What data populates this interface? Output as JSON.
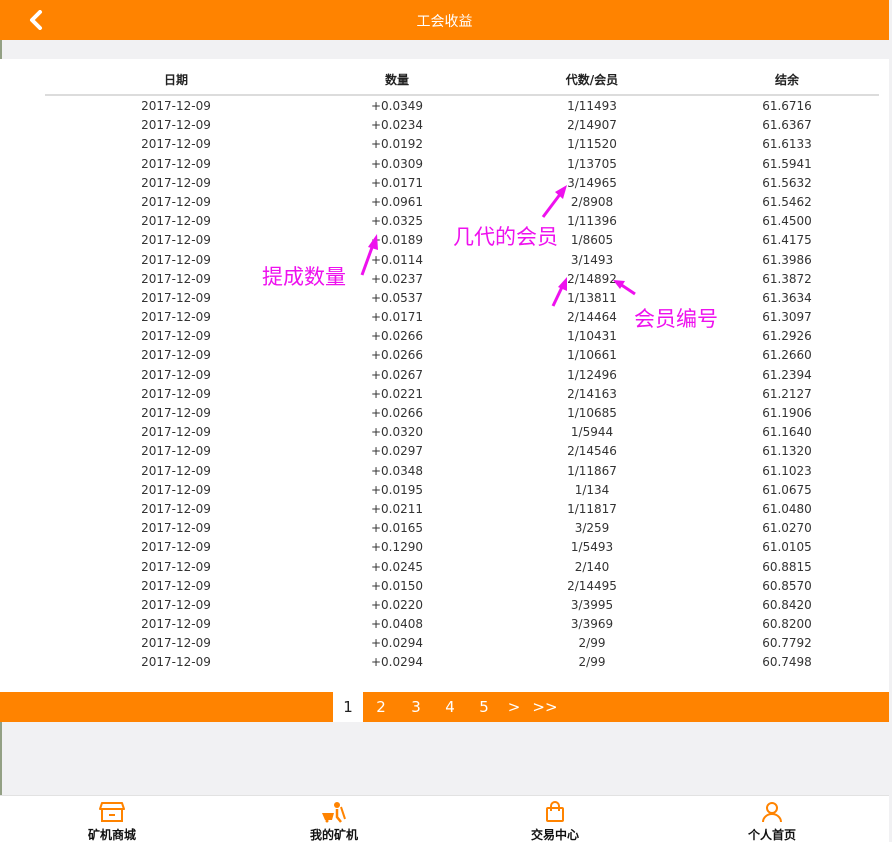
{
  "header": {
    "title": "工会收益",
    "back_icon": "chevron-left-icon"
  },
  "table": {
    "columns": [
      "日期",
      "数量",
      "代数/会员",
      "结余"
    ],
    "rows": [
      [
        "2017-12-09",
        "+0.0349",
        "1/11493",
        "61.6716"
      ],
      [
        "2017-12-09",
        "+0.0234",
        "2/14907",
        "61.6367"
      ],
      [
        "2017-12-09",
        "+0.0192",
        "1/11520",
        "61.6133"
      ],
      [
        "2017-12-09",
        "+0.0309",
        "1/13705",
        "61.5941"
      ],
      [
        "2017-12-09",
        "+0.0171",
        "3/14965",
        "61.5632"
      ],
      [
        "2017-12-09",
        "+0.0961",
        "2/8908",
        "61.5462"
      ],
      [
        "2017-12-09",
        "+0.0325",
        "1/11396",
        "61.4500"
      ],
      [
        "2017-12-09",
        "+0.0189",
        "1/8605",
        "61.4175"
      ],
      [
        "2017-12-09",
        "+0.0114",
        "3/1493",
        "61.3986"
      ],
      [
        "2017-12-09",
        "+0.0237",
        "2/14892",
        "61.3872"
      ],
      [
        "2017-12-09",
        "+0.0537",
        "1/13811",
        "61.3634"
      ],
      [
        "2017-12-09",
        "+0.0171",
        "2/14464",
        "61.3097"
      ],
      [
        "2017-12-09",
        "+0.0266",
        "1/10431",
        "61.2926"
      ],
      [
        "2017-12-09",
        "+0.0266",
        "1/10661",
        "61.2660"
      ],
      [
        "2017-12-09",
        "+0.0267",
        "1/12496",
        "61.2394"
      ],
      [
        "2017-12-09",
        "+0.0221",
        "2/14163",
        "61.2127"
      ],
      [
        "2017-12-09",
        "+0.0266",
        "1/10685",
        "61.1906"
      ],
      [
        "2017-12-09",
        "+0.0320",
        "1/5944",
        "61.1640"
      ],
      [
        "2017-12-09",
        "+0.0297",
        "2/14546",
        "61.1320"
      ],
      [
        "2017-12-09",
        "+0.0348",
        "1/11867",
        "61.1023"
      ],
      [
        "2017-12-09",
        "+0.0195",
        "1/134",
        "61.0675"
      ],
      [
        "2017-12-09",
        "+0.0211",
        "1/11817",
        "61.0480"
      ],
      [
        "2017-12-09",
        "+0.0165",
        "3/259",
        "61.0270"
      ],
      [
        "2017-12-09",
        "+0.1290",
        "1/5493",
        "61.0105"
      ],
      [
        "2017-12-09",
        "+0.0245",
        "2/140",
        "60.8815"
      ],
      [
        "2017-12-09",
        "+0.0150",
        "2/14495",
        "60.8570"
      ],
      [
        "2017-12-09",
        "+0.0220",
        "3/3995",
        "60.8420"
      ],
      [
        "2017-12-09",
        "+0.0408",
        "3/3969",
        "60.8200"
      ],
      [
        "2017-12-09",
        "+0.0294",
        "2/99",
        "60.7792"
      ],
      [
        "2017-12-09",
        "+0.0294",
        "2/99",
        "60.7498"
      ]
    ]
  },
  "annotations": {
    "withdraw_amount": "提成数量",
    "generation_member": "几代的会员",
    "member_id": "会员编号"
  },
  "pagination": {
    "pages": [
      "1",
      "2",
      "3",
      "4",
      "5"
    ],
    "current": "1",
    "next": ">",
    "last": ">>"
  },
  "footer": {
    "tabs": [
      {
        "label": "矿机商城",
        "icon": "shop-icon"
      },
      {
        "label": "我的矿机",
        "icon": "miner-icon"
      },
      {
        "label": "交易中心",
        "icon": "shopping-bag-icon"
      },
      {
        "label": "个人首页",
        "icon": "user-icon"
      }
    ]
  },
  "colors": {
    "accent": "#ff8300",
    "annotation": "#ee11ee"
  }
}
